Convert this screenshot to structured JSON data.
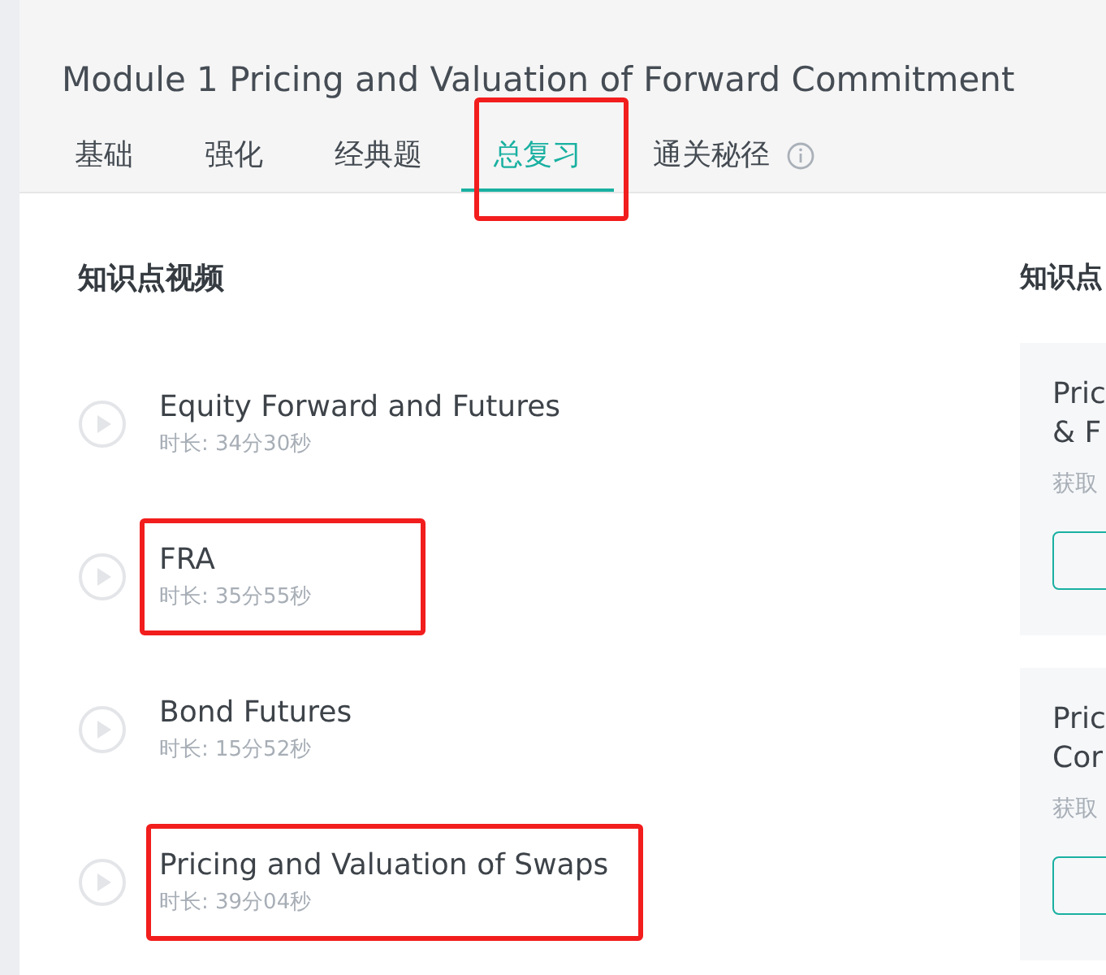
{
  "title": "Module 1 Pricing and Valuation of Forward Commitment",
  "tabs": [
    {
      "label": "基础",
      "selected": false,
      "highlighted": false
    },
    {
      "label": "强化",
      "selected": false,
      "highlighted": false
    },
    {
      "label": "经典题",
      "selected": false,
      "highlighted": false
    },
    {
      "label": "总复习",
      "selected": true,
      "highlighted": true
    },
    {
      "label": "通关秘径",
      "selected": false,
      "highlighted": false
    }
  ],
  "videos": {
    "heading": "知识点视频",
    "items": [
      {
        "title": "Equity Forward and Futures",
        "duration": "时长: 34分30秒",
        "highlighted": false
      },
      {
        "title": "FRA",
        "duration": "时长: 35分55秒",
        "highlighted": true
      },
      {
        "title": "Bond Futures",
        "duration": "时长: 15分52秒",
        "highlighted": false
      },
      {
        "title": "Pricing and Valuation of Swaps",
        "duration": "时长: 39分04秒",
        "highlighted": true
      }
    ]
  },
  "side": {
    "heading": "知识点",
    "cards": [
      {
        "title_lines": [
          "Pric",
          "& F"
        ],
        "note": "获取"
      },
      {
        "title_lines": [
          "Pric",
          "Cor"
        ],
        "note": "获取"
      }
    ]
  }
}
